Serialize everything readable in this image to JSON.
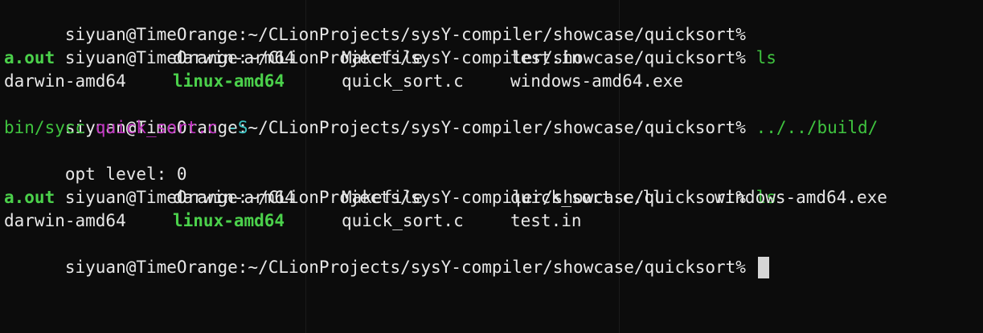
{
  "terminal": {
    "prompt": "siyuan@TimeOrange:~/CLionProjects/sysY-compiler/showcase/quicksort%",
    "lines": [
      {
        "kind": "prompt",
        "command": ""
      },
      {
        "kind": "prompt",
        "command": "ls"
      },
      {
        "kind": "ls",
        "cells": [
          "a.out",
          "darwin-arm64",
          "Makefile",
          "test.in"
        ]
      },
      {
        "kind": "ls",
        "cells": [
          "darwin-amd64",
          "linux-amd64",
          "quick_sort.c",
          "windows-amd64.exe"
        ]
      },
      {
        "kind": "prompt",
        "command": "../../build/"
      },
      {
        "kind": "continuation",
        "parts": [
          "bin/sycc",
          "quick_sort.c",
          "-S"
        ]
      },
      {
        "kind": "output",
        "text": "opt level: 0"
      },
      {
        "kind": "prompt",
        "command": "ls"
      },
      {
        "kind": "ls",
        "cells": [
          "a.out",
          "darwin-arm64",
          "Makefile",
          "quick_sort.c.ll",
          "windows-amd64.exe"
        ]
      },
      {
        "kind": "ls",
        "cells": [
          "darwin-amd64",
          "linux-amd64",
          "quick_sort.c",
          "test.in"
        ]
      },
      {
        "kind": "prompt",
        "command": ""
      }
    ]
  },
  "colors": {
    "background": "#0c0c0c",
    "foreground": "#e8e8e8",
    "executable": "#4bd14b",
    "command": "#3fc43f",
    "argument": "#c233c2",
    "flag": "#3cc2c2",
    "cursor": "#d6d6d6"
  }
}
